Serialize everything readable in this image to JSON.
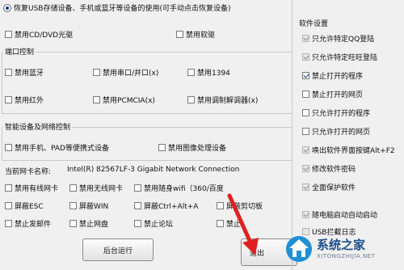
{
  "top_option": "恢复USB存储设备、手机或蓝牙等设备的使用(可手动点击恢复设备)",
  "optical": {
    "cd_dvd": "禁用CD/DVD光驱",
    "floppy": "禁用软驱"
  },
  "ports": {
    "legend": "端口控制",
    "bluetooth": "禁用蓝牙",
    "serial": "禁用串口/并口(x)",
    "ieee1394": "禁用1394",
    "infrared": "禁用红外",
    "pcmcia": "禁用PCMCIA(x)",
    "modem": "禁用调制解调器(x)"
  },
  "smart": {
    "legend": "智能设备及网络控制",
    "phone_pad": "禁用手机、PAD等便携式设备",
    "imaging": "禁用图像处理设备"
  },
  "nic": {
    "label": "当前网卡名称:",
    "value": "Intel(R) 82567LF-3 Gigabit Network Connection"
  },
  "network": {
    "row1": [
      "禁用有线网卡",
      "禁用无线网卡",
      "禁用随身wifi（360/百度"
    ],
    "row2": [
      "屏蔽ESC",
      "屏蔽WIN",
      "屏蔽Ctrl+Alt+A",
      "屏蔽剪切板"
    ],
    "row3": [
      "禁止发邮件",
      "禁止网盘",
      "禁止论坛",
      "禁止"
    ]
  },
  "buttons": {
    "background_run": "后台运行",
    "exit": "退出"
  },
  "software": {
    "legend": "软件设置",
    "items": [
      {
        "label": "只允许特定QQ登陆",
        "checked": true,
        "disabled": true
      },
      {
        "label": "只允许特定旺旺登陆",
        "checked": true,
        "disabled": true
      },
      {
        "label": "禁止打开的程序",
        "checked": true,
        "disabled": false
      },
      {
        "label": "禁止打开的网页",
        "checked": false,
        "disabled": false
      },
      {
        "label": "只允许打开的程序",
        "checked": false,
        "disabled": false
      },
      {
        "label": "只允许打开的网页",
        "checked": false,
        "disabled": false
      },
      {
        "label": "唤出软件界面按键Alt+F2",
        "checked": true,
        "disabled": true
      },
      {
        "label": "修改软件密码",
        "checked": true,
        "disabled": true
      },
      {
        "label": "全面保护软件",
        "checked": true,
        "disabled": true
      }
    ],
    "autostart": "随电脑启动自动启动",
    "usb_log": "USB拦截日志"
  },
  "watermark": {
    "text": "系统之家",
    "url": "XITONGZHIJIA.NET"
  }
}
